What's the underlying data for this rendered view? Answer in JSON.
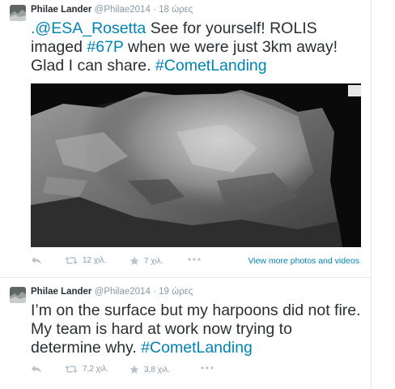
{
  "tweets": [
    {
      "fullname": "Philae Lander",
      "username": "@Philae2014",
      "separator": "·",
      "time": "18 ώρες",
      "text_parts": [
        ".@ESA_Rosetta",
        " See for yourself! ROLIS imaged ",
        "#67P",
        " when we were just 3km away! Glad I can share. ",
        "#CometLanding"
      ],
      "retweets": "12 χιλ.",
      "favorites": "7 χιλ.",
      "view_more": "View more photos and videos"
    },
    {
      "fullname": "Philae Lander",
      "username": "@Philae2014",
      "separator": "·",
      "time": "19 ώρες",
      "text_parts": [
        "I’m on the surface but my harpoons did not fire. My team is hard at work now trying to determine why. ",
        "#CometLanding"
      ],
      "retweets": "7,2 χιλ.",
      "favorites": "3,8 χιλ."
    }
  ],
  "icons": {
    "reply": "reply-icon",
    "retweet": "retweet-icon",
    "favorite": "star-icon",
    "more": "more-dots-icon"
  },
  "colors": {
    "link": "#0084b4",
    "muted": "#8899a6",
    "text": "#292f33"
  }
}
